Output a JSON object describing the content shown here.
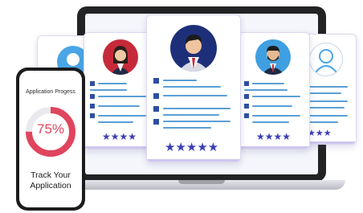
{
  "phone": {
    "title": "Application Progess",
    "progress_percent": 75,
    "progress_label": "75%",
    "caption_line1": "Track Your",
    "caption_line2": "Application"
  },
  "cards": [
    {
      "id": "far-left",
      "stars": "",
      "rating": 0
    },
    {
      "id": "left",
      "stars": "★★★★",
      "rating": 4
    },
    {
      "id": "center",
      "stars": "★★★★★",
      "rating": 5
    },
    {
      "id": "right",
      "stars": "★★★★",
      "rating": 4
    },
    {
      "id": "far-right",
      "stars": "★★★",
      "rating": 3
    }
  ],
  "colors": {
    "accent": "#3c3fb4",
    "progress": "#e0455e",
    "progress_track": "#e9e9ee",
    "line": "#5a9fd6",
    "bullet": "#2f4fa3"
  },
  "icons": {
    "avatar": "user-avatar-icon",
    "star": "star-icon"
  }
}
